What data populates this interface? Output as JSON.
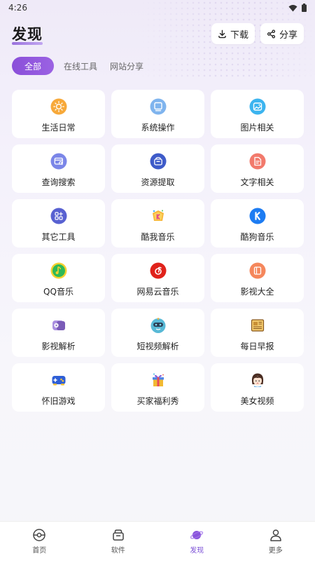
{
  "status": {
    "time": "4:26"
  },
  "header": {
    "title": "发现",
    "download_label": "下载",
    "share_label": "分享"
  },
  "tabs": [
    "全部",
    "在线工具",
    "网站分享"
  ],
  "grid": [
    {
      "label": "生活日常",
      "icon": "sun-icon"
    },
    {
      "label": "系统操作",
      "icon": "monitor-icon"
    },
    {
      "label": "图片相关",
      "icon": "image-icon"
    },
    {
      "label": "查询搜索",
      "icon": "card-search-icon"
    },
    {
      "label": "资源提取",
      "icon": "box-icon"
    },
    {
      "label": "文字相关",
      "icon": "document-icon"
    },
    {
      "label": "其它工具",
      "icon": "apps-icon"
    },
    {
      "label": "酷我音乐",
      "icon": "kuwo-music-icon"
    },
    {
      "label": "酷狗音乐",
      "icon": "kugou-music-icon"
    },
    {
      "label": "QQ音乐",
      "icon": "qq-music-icon"
    },
    {
      "label": "网易云音乐",
      "icon": "netease-music-icon"
    },
    {
      "label": "影视大全",
      "icon": "video-collection-icon"
    },
    {
      "label": "影视解析",
      "icon": "video-parse-icon"
    },
    {
      "label": "短视频解析",
      "icon": "short-video-icon"
    },
    {
      "label": "每日早报",
      "icon": "newspaper-icon"
    },
    {
      "label": "怀旧游戏",
      "icon": "gamepad-icon"
    },
    {
      "label": "买家福利秀",
      "icon": "gift-icon"
    },
    {
      "label": "美女视频",
      "icon": "girl-avatar-icon"
    }
  ],
  "bottom_nav": [
    {
      "label": "首页",
      "icon": "home-icon"
    },
    {
      "label": "软件",
      "icon": "software-icon"
    },
    {
      "label": "发现",
      "icon": "planet-icon"
    },
    {
      "label": "更多",
      "icon": "user-icon"
    }
  ],
  "colors": {
    "accent": "#8a4fd9",
    "background": "#f4f1fb"
  }
}
